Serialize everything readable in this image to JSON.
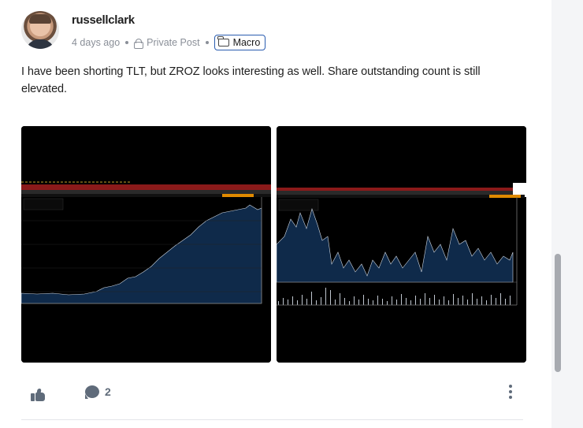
{
  "post": {
    "author": "russellclark",
    "time_ago": "4 days ago",
    "visibility": "Private Post",
    "category": "Macro",
    "body": "I have been shorting TLT, but ZROZ looks interesting as well.  Share outstanding count is still elevated.",
    "comment_count": "2"
  },
  "attachments": [
    {
      "icon": "bloomberg-area-chart"
    },
    {
      "icon": "bloomberg-line-volume-chart"
    }
  ],
  "icons": {
    "like": "thumbs-up-icon",
    "comment": "comment-icon",
    "more": "kebab-menu-icon",
    "visibility": "lock-icon",
    "category": "folder-icon"
  },
  "colors": {
    "tag_border": "#2a5db0",
    "meta_text": "#8a8f98",
    "action_icon": "#5f6b7a",
    "chart_fill": "#0f2a4a",
    "chart_header_red": "#8b1a1a"
  }
}
